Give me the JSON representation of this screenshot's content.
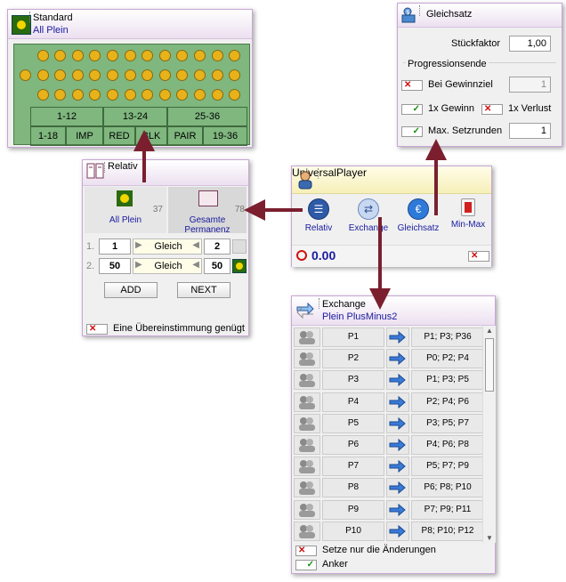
{
  "standard": {
    "title": "Standard",
    "subtitle": "All Plein",
    "dozens": [
      "1-12",
      "13-24",
      "25-36"
    ],
    "chances": [
      "1-18",
      "IMP",
      "RED",
      "BLK",
      "PAIR",
      "19-36"
    ]
  },
  "gleichsatz": {
    "title": "Gleichsatz",
    "stueckfaktor_label": "Stückfaktor",
    "stueckfaktor_value": "1,00",
    "section_label": "Progressionsende",
    "gewinnziel_label": "Bei Gewinnziel",
    "gewinnziel_value": "1",
    "gewinn_label": "1x Gewinn",
    "verlust_label": "1x Verlust",
    "setzrunden_label": "Max. Setzrunden",
    "setzrunden_value": "1"
  },
  "universal": {
    "title": "UniversalPlayer",
    "buttons": [
      "Relativ",
      "Exchange",
      "Gleichsatz",
      "Min-Max"
    ],
    "amount": "0.00"
  },
  "relativ": {
    "title": "Relativ",
    "col1_label": "All Plein",
    "col1_count": "37",
    "col2_label": "Gesamte Permanenz",
    "col2_count": "78",
    "rows": [
      {
        "idx": "1.",
        "left": "1",
        "mode": "Gleich",
        "right": "2"
      },
      {
        "idx": "2.",
        "left": "50",
        "mode": "Gleich",
        "right": "50"
      }
    ],
    "add_label": "ADD",
    "next_label": "NEXT",
    "footer_label": "Eine Übereinstimmung genügt"
  },
  "exchange": {
    "title": "Exchange",
    "subtitle": "Plein PlusMinus2",
    "rows": [
      {
        "from": "P1",
        "to": "P1; P3; P36"
      },
      {
        "from": "P2",
        "to": "P0; P2; P4"
      },
      {
        "from": "P3",
        "to": "P1; P3; P5"
      },
      {
        "from": "P4",
        "to": "P2; P4; P6"
      },
      {
        "from": "P5",
        "to": "P3; P5; P7"
      },
      {
        "from": "P6",
        "to": "P4; P6; P8"
      },
      {
        "from": "P7",
        "to": "P5; P7; P9"
      },
      {
        "from": "P8",
        "to": "P6; P8; P10"
      },
      {
        "from": "P9",
        "to": "P7; P9; P11"
      },
      {
        "from": "P10",
        "to": "P8; P10; P12"
      }
    ],
    "check1_label": "Setze nur die Änderungen",
    "check2_label": "Anker"
  },
  "colors": {
    "arrow": "#7b1f2f",
    "accent_blue": "#1a1aa0",
    "felt": "#7fb77e",
    "chip": "#e8b21a"
  }
}
